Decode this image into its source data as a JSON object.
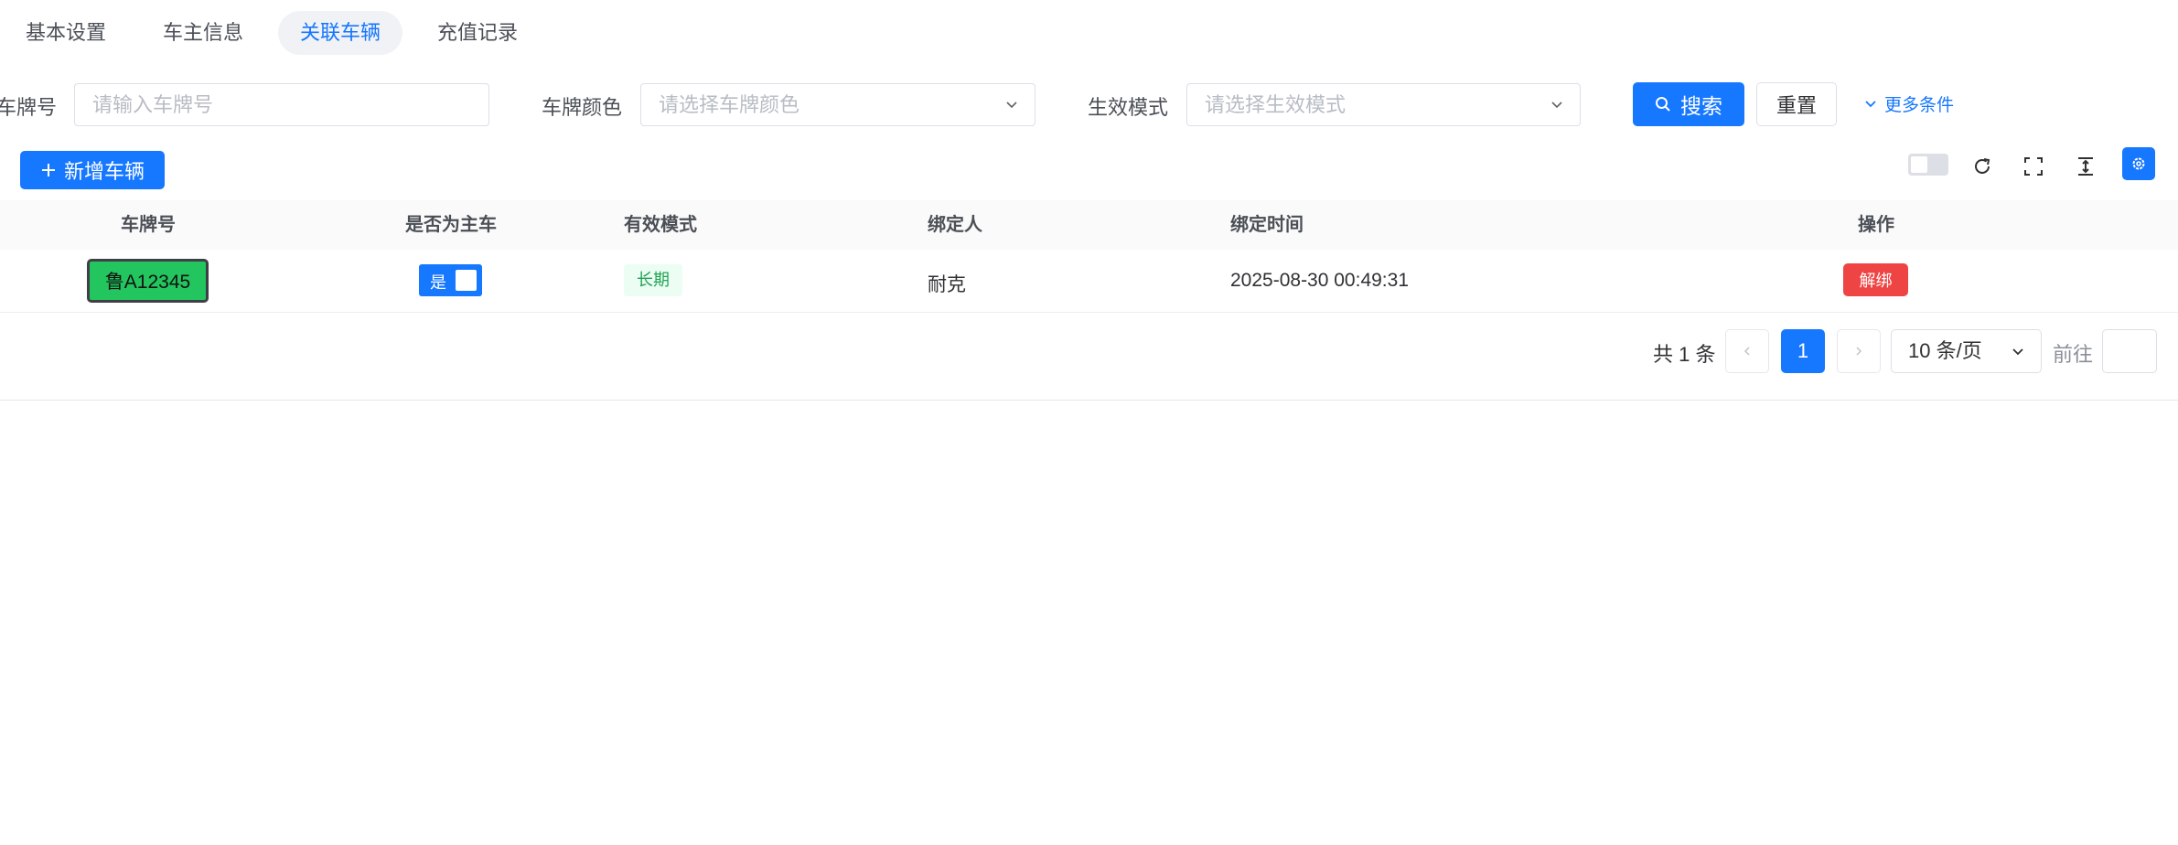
{
  "tabs": [
    {
      "label": "基本设置",
      "active": false
    },
    {
      "label": "车主信息",
      "active": false
    },
    {
      "label": "关联车辆",
      "active": true
    },
    {
      "label": "充值记录",
      "active": false
    }
  ],
  "filters": {
    "plate_label": "车牌号",
    "plate_placeholder": "请输入车牌号",
    "color_label": "车牌颜色",
    "color_placeholder": "请选择车牌颜色",
    "mode_label": "生效模式",
    "mode_placeholder": "请选择生效模式",
    "search_label": "搜索",
    "reset_label": "重置",
    "more_label": "更多条件"
  },
  "toolbar": {
    "add_label": "新增车辆"
  },
  "table": {
    "columns": [
      "车牌号",
      "是否为主车",
      "有效模式",
      "绑定人",
      "绑定时间",
      "操作"
    ],
    "rows": [
      {
        "plate": "鲁A12345",
        "plate_color": "#22c55e",
        "is_main": "是",
        "mode": "长期",
        "binder": "耐克",
        "bind_time": "2025-08-30 00:49:31",
        "action": "解绑"
      }
    ]
  },
  "pagination": {
    "total_text": "共 1 条",
    "current_page": "1",
    "page_size": "10 条/页",
    "goto_label": "前往",
    "goto_value": ""
  },
  "colors": {
    "primary": "#1677ff",
    "danger": "#ef4444",
    "success_tag": "#22a355"
  }
}
